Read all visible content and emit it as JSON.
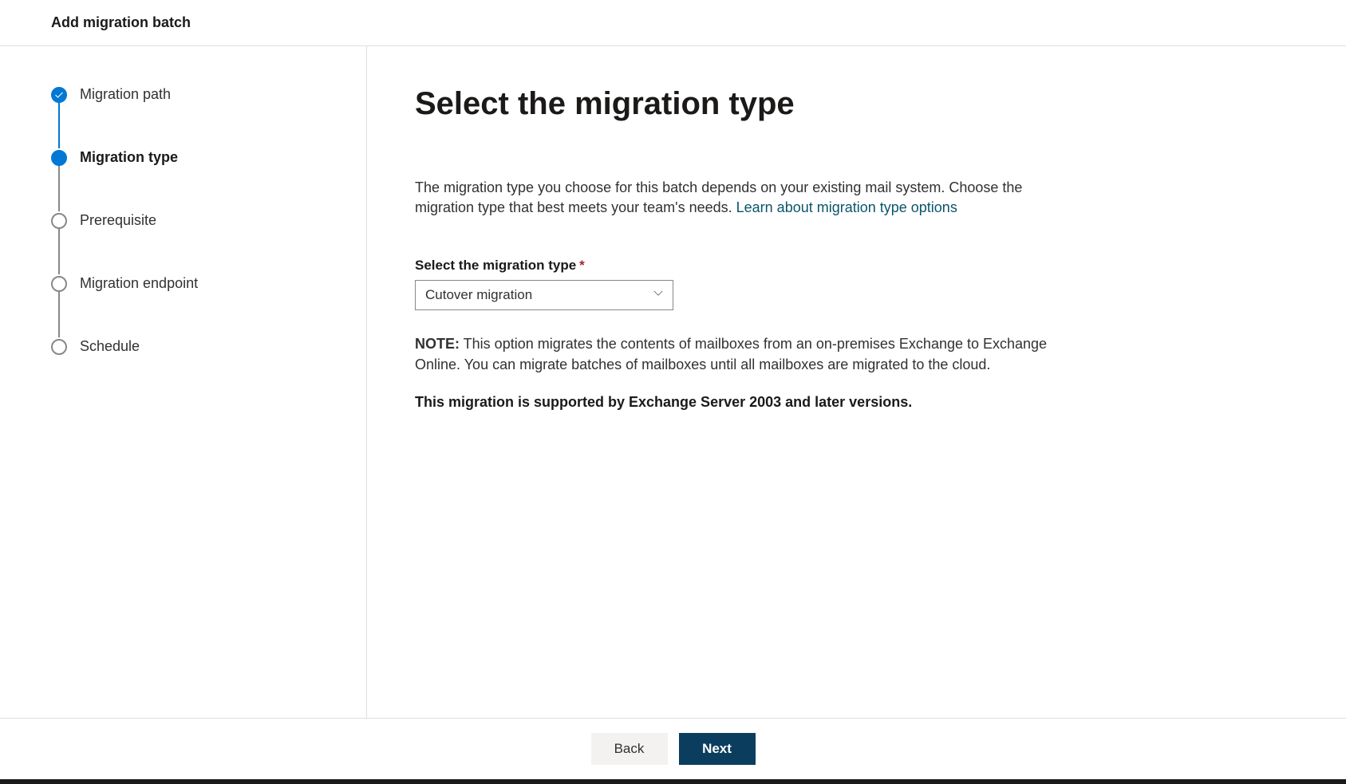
{
  "header": {
    "title": "Add migration batch"
  },
  "stepper": {
    "steps": [
      {
        "label": "Migration path",
        "state": "completed"
      },
      {
        "label": "Migration type",
        "state": "current"
      },
      {
        "label": "Prerequisite",
        "state": "upcoming"
      },
      {
        "label": "Migration endpoint",
        "state": "upcoming"
      },
      {
        "label": "Schedule",
        "state": "upcoming"
      }
    ]
  },
  "content": {
    "title": "Select the migration type",
    "description_text": "The migration type you choose for this batch depends on your existing mail system. Choose the migration type that best meets your team's needs. ",
    "description_link": "Learn about migration type options",
    "form": {
      "label": "Select the migration type",
      "required_marker": "*",
      "selected_value": "Cutover migration"
    },
    "note_label": "NOTE:",
    "note_text": " This option migrates the contents of mailboxes from an on-premises Exchange to Exchange Online. You can migrate batches of mailboxes until all mailboxes are migrated to the cloud.",
    "support_text": "This migration is supported by Exchange Server 2003 and later versions."
  },
  "footer": {
    "back_label": "Back",
    "next_label": "Next"
  }
}
